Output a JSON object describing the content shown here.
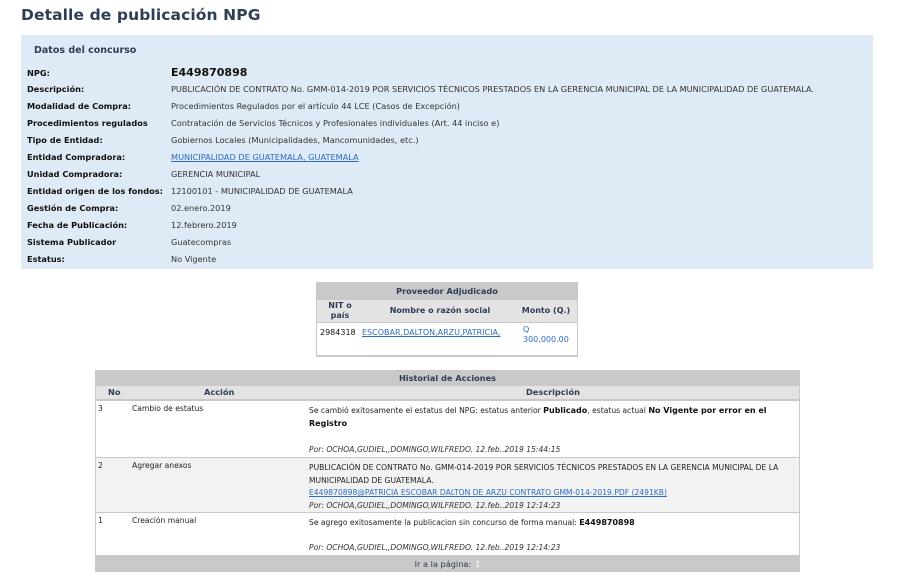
{
  "page": {
    "title": "Detalle de publicación NPG"
  },
  "datos": {
    "header": "Datos del concurso",
    "fields": [
      {
        "label": "NPG:",
        "value": "E449870898"
      },
      {
        "label": "Descripción:",
        "value": "PUBLICACIÓN DE CONTRATO No. GMM-014-2019 POR SERVICIOS TÉCNICOS PRESTADOS EN LA GERENCIA MUNICIPAL DE LA MUNICIPALIDAD DE GUATEMALA."
      },
      {
        "label": "Modalidad de Compra:",
        "value": "Procedimientos Regulados por el artículo 44 LCE (Casos de Excepción)"
      },
      {
        "label": "Procedimientos regulados",
        "value": "Contratación de Servicios Técnicos y Profesionales individuales (Art. 44 inciso e)"
      },
      {
        "label": "Tipo de Entidad:",
        "value": "Gobiernos Locales (Municipalidades, Mancomunidades, etc.)"
      },
      {
        "label": "Entidad Compradora:",
        "value": "MUNICIPALIDAD DE GUATEMALA, GUATEMALA"
      },
      {
        "label": "Unidad Compradora:",
        "value": "GERENCIA MUNICIPAL"
      },
      {
        "label": "Entidad origen de los fondos:",
        "value": "12100101 - MUNICIPALIDAD DE GUATEMALA"
      },
      {
        "label": "Gestión de Compra:",
        "value": "02.enero.2019"
      },
      {
        "label": "Fecha de Publicación:",
        "value": "12.febrero.2019"
      },
      {
        "label": "Sistema Publicador",
        "value": "Guatecompras"
      },
      {
        "label": "Estatus:",
        "value": "No Vigente"
      }
    ]
  },
  "proveedor": {
    "title": "Proveedor Adjudicado",
    "headers": {
      "nit": "NIT o país",
      "nombre": "Nombre o razón social",
      "monto": "Monto (Q.)"
    },
    "row": {
      "nit": "2984318",
      "nombre": "ESCOBAR,DALTON,ARZU,PATRICIA,",
      "monto": "Q 300,000.00"
    }
  },
  "historial": {
    "title": "Historial de Acciones",
    "headers": {
      "no": "No",
      "accion": "Acción",
      "descripcion": "Descripción"
    },
    "rows": [
      {
        "no": "3",
        "accion": "Cambio de estatus",
        "desc_prefix": "Se cambió exitosamente el estatus del NPG: estatus anterior ",
        "desc_bold1": "Publicado",
        "desc_mid": ", estatus actual ",
        "desc_bold2": "No Vigente por error en el Registro",
        "por": "Por:  OCHOA,GUDIEL,,DOMINGO,WILFREDO.  12.feb..2019 15:44:15"
      },
      {
        "no": "2",
        "accion": "Agregar anexos",
        "desc": "PUBLICACIÓN DE CONTRATO No. GMM-014-2019 POR SERVICIOS TÉCNICOS PRESTADOS EN LA GERENCIA MUNICIPAL DE LA MUNICIPALIDAD DE GUATEMALA.",
        "link": "E449870898@PATRICIA ESCOBAR DALTON DE ARZU CONTRATO GMM-014-2019.PDF (2491KB)",
        "por": "Por:  OCHOA,GUDIEL,,DOMINGO,WILFREDO.  12.feb..2019 12:14:23"
      },
      {
        "no": "1",
        "accion": "Creación manual",
        "desc_prefix": "Se agrego exitosamente la publicacion sin concurso de forma manual: ",
        "desc_bold": "E449870898",
        "por": "Por:  OCHOA,GUDIEL,,DOMINGO,WILFREDO.  12.feb..2019 12:14:23"
      }
    ],
    "footer_label": "Ir a la página:",
    "footer_page": "1"
  }
}
